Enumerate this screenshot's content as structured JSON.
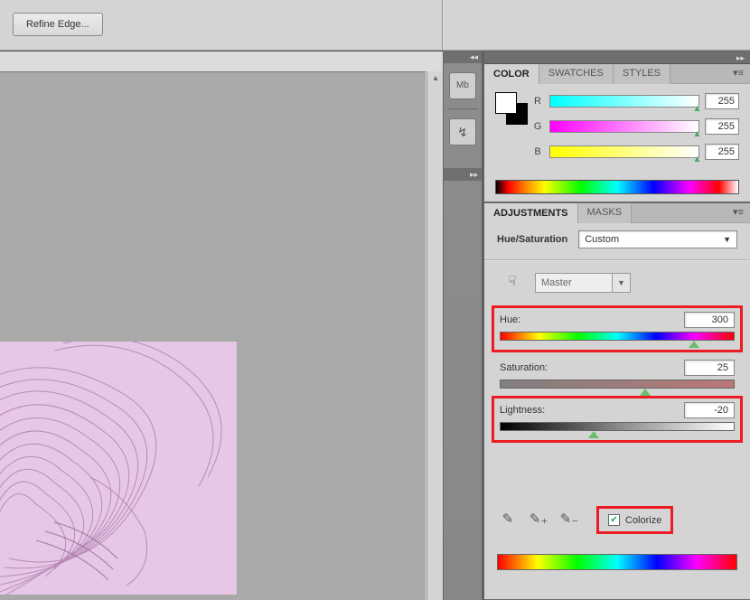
{
  "option_bar": {
    "refine_edge": "Refine Edge..."
  },
  "color_panel": {
    "tabs": [
      "COLOR",
      "SWATCHES",
      "STYLES"
    ],
    "active_tab": 0,
    "channels": {
      "r": {
        "label": "R",
        "value": "255"
      },
      "g": {
        "label": "G",
        "value": "255"
      },
      "b": {
        "label": "B",
        "value": "255"
      }
    }
  },
  "adjustments_panel": {
    "tabs": [
      "ADJUSTMENTS",
      "MASKS"
    ],
    "active_tab": 0,
    "type_label": "Hue/Saturation",
    "preset": "Custom",
    "range_label": "Master",
    "hue": {
      "label": "Hue:",
      "value": "300",
      "pos": 83
    },
    "saturation": {
      "label": "Saturation:",
      "value": "25",
      "pos": 62
    },
    "lightness": {
      "label": "Lightness:",
      "value": "-20",
      "pos": 40
    },
    "colorize": {
      "label": "Colorize",
      "checked": true
    }
  },
  "dock": {
    "icon1": "Mb",
    "icon2": "↯"
  }
}
